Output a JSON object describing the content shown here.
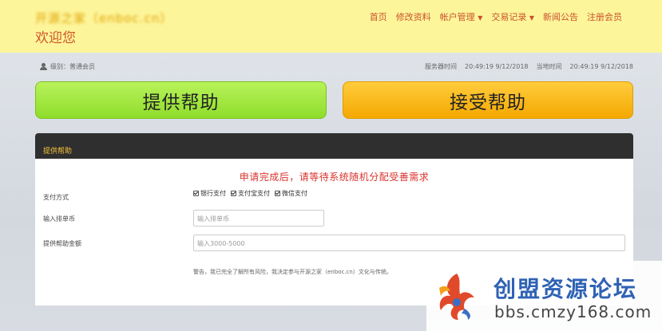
{
  "header": {
    "brand": "开源之家（enboc.cn）",
    "welcome": "欢迎您",
    "nav": [
      {
        "label": "首页",
        "dropdown": false
      },
      {
        "label": "修改资料",
        "dropdown": false
      },
      {
        "label": "帐户管理",
        "dropdown": true
      },
      {
        "label": "交易记录",
        "dropdown": true
      },
      {
        "label": "新闻公告",
        "dropdown": false
      },
      {
        "label": "注册会员",
        "dropdown": false
      }
    ]
  },
  "info_bar": {
    "level": "级别：普通会员",
    "server_time_label": "服务器时间",
    "server_time": "20:49:19 9/12/2018",
    "local_time_label": "当地时间",
    "local_time": "20:49:19 9/12/2018"
  },
  "actions": {
    "provide_label": "提供帮助",
    "accept_label": "接受帮助"
  },
  "panel": {
    "title": "提供帮助",
    "notice": "申请完成后，请等待系统随机分配受善需求",
    "payment_label": "支付方式",
    "payment_options": [
      "银行支付",
      "支付宝支付",
      "微信支付"
    ],
    "coin_label": "输入排单币",
    "coin_placeholder": "输入排单币",
    "amount_label": "提供帮助金额",
    "amount_placeholder": "输入3000-5000",
    "warning": "警告，我已完全了解所有风险，我决定参与开源之家（enboc.cn）文化与传统。"
  },
  "watermark": {
    "title": "创盟资源论坛",
    "url": "bbs.cmzy168.com"
  },
  "colors": {
    "header_bg": "#fdf59a",
    "nav_text": "#c9522e",
    "provide_button": "#9be33a",
    "accept_button": "#f9b91a",
    "panel_header": "#2f2f2f",
    "notice_text": "#d9332c"
  }
}
